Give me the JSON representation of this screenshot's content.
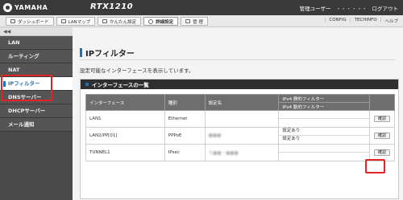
{
  "header": {
    "brand": "YAMAHA",
    "model": "RTX1210",
    "user_label": "管理ユーザー",
    "user_name": "・・・・・・",
    "logout": "ログアウト"
  },
  "tabs": [
    {
      "label": "ダッシュボード",
      "icon": "dashboard-icon"
    },
    {
      "label": "LANマップ",
      "icon": "lan-map-icon"
    },
    {
      "label": "かんたん設定",
      "icon": "easy-setup-icon"
    },
    {
      "label": "詳細設定",
      "icon": "gear-icon",
      "active": true
    },
    {
      "label": "管 理",
      "icon": "wrench-icon"
    }
  ],
  "util_links": [
    "CONFIG",
    "TECHINFO",
    "ヘルプ"
  ],
  "sidebar": {
    "collapse": "◀◀",
    "items": [
      {
        "label": "LAN"
      },
      {
        "label": "ルーティング"
      },
      {
        "label": "NAT"
      },
      {
        "label": "IPフィルター",
        "active": true
      },
      {
        "label": "DNSサーバー"
      },
      {
        "label": "DHCPサーバー"
      },
      {
        "label": "メール通知"
      }
    ]
  },
  "main": {
    "title": "IPフィルター",
    "description": "設定可能なインターフェースを表示しています。",
    "panel_title": "インターフェースの一覧",
    "table": {
      "headers": [
        "インターフェース",
        "種別",
        "設定名",
        "IPv4 静的フィルター",
        "IPv4 動的フィルター"
      ],
      "rows": [
        {
          "interface": "LAN1",
          "type": "Ethernet",
          "name": "",
          "static": "",
          "dynamic": "",
          "button": "確認"
        },
        {
          "interface": "LAN2/PP[01]",
          "type": "PPPoE",
          "name": "■■■",
          "static": "設定あり",
          "dynamic": "設定あり",
          "button": "確認"
        },
        {
          "interface": "TUNNEL1",
          "type": "IPsec",
          "name": "大■■・■■■",
          "static": "",
          "dynamic": "",
          "button": "確認"
        }
      ]
    }
  },
  "colors": {
    "accent": "#1a73b8",
    "highlight": "#e32424",
    "header": "#3a3a3a"
  }
}
